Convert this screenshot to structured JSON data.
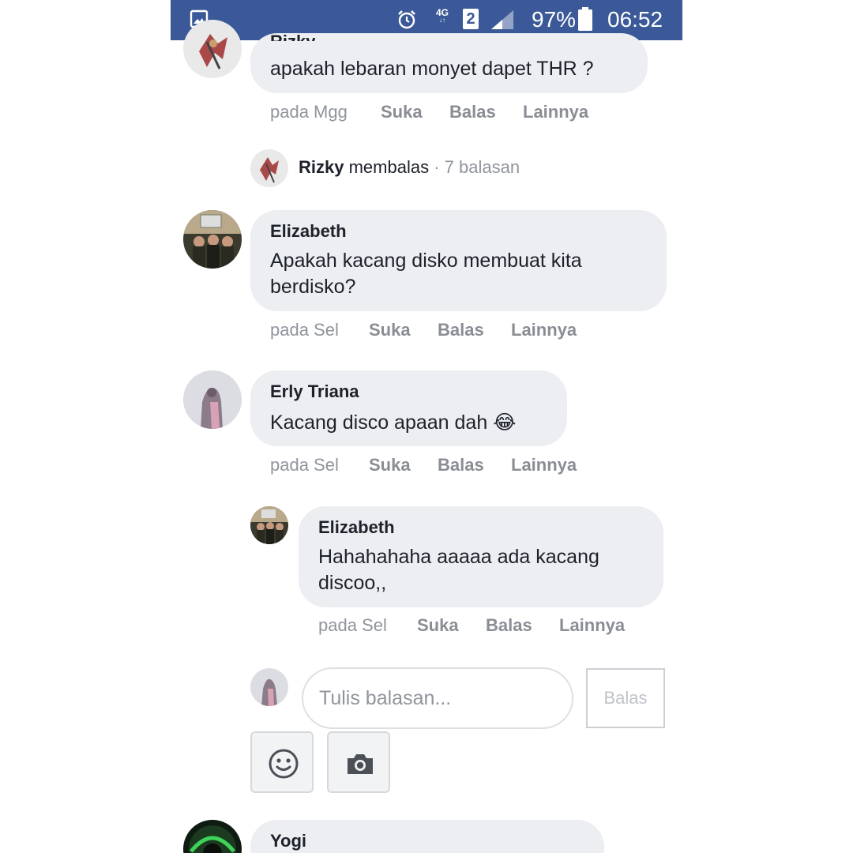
{
  "status_bar": {
    "network": "4G",
    "network_sub": "↓↑",
    "sim_slot": "2",
    "battery_percent": "97%",
    "time": "06:52",
    "icons": [
      "gallery-icon",
      "alarm-icon",
      "signal-icon",
      "battery-icon"
    ]
  },
  "comments": [
    {
      "author": "Rizky",
      "text": "apakah lebaran monyet dapet THR ?",
      "time": "pada Mgg",
      "actions": [
        "Suka",
        "Balas",
        "Lainnya"
      ]
    },
    {
      "author": "Elizabeth",
      "text_lines": [
        "Apakah kacang disko membuat kita",
        "berdisko?"
      ],
      "time": "pada Sel",
      "actions": [
        "Suka",
        "Balas",
        "Lainnya"
      ]
    },
    {
      "author": "Erly Triana",
      "text": "Kacang disco apaan dah",
      "emoji": "😂",
      "time": "pada Sel",
      "actions": [
        "Suka",
        "Balas",
        "Lainnya"
      ]
    },
    {
      "author": "Elizabeth",
      "text_lines": [
        "Hahahahaha aaaaa ada kacang",
        "discoo,,"
      ],
      "time": "pada Sel",
      "actions": [
        "Suka",
        "Balas",
        "Lainnya"
      ]
    },
    {
      "author": "Yogi"
    }
  ],
  "reply_summary": {
    "name": "Rizky",
    "verb": "membalas",
    "count": " · 7 balasan"
  },
  "reply_box": {
    "placeholder": "Tulis balasan...",
    "button_label": "Balas"
  },
  "colors": {
    "header": "#3b5998",
    "bubble": "#eceef2",
    "meta_text": "#90949c"
  }
}
